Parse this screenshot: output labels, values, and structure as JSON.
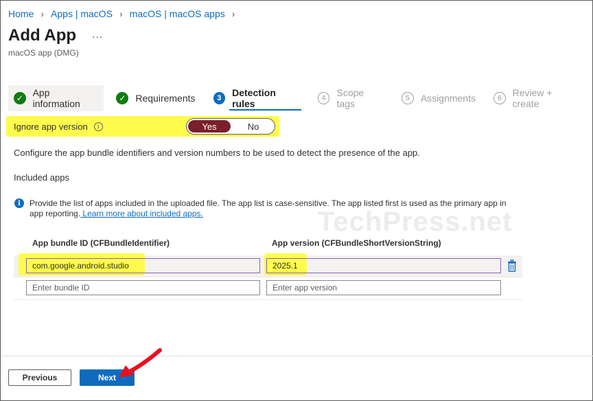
{
  "breadcrumb": {
    "items": [
      "Home",
      "Apps | macOS",
      "macOS | macOS apps"
    ]
  },
  "page": {
    "title": "Add App",
    "more": "...",
    "subtitle": "macOS app (DMG)"
  },
  "tabs": [
    {
      "label": "App information",
      "state": "complete"
    },
    {
      "label": "Requirements",
      "state": "complete"
    },
    {
      "label": "Detection rules",
      "number": "3",
      "state": "current"
    },
    {
      "label": "Scope tags",
      "number": "4",
      "state": "disabled"
    },
    {
      "label": "Assignments",
      "number": "5",
      "state": "disabled"
    },
    {
      "label": "Review + create",
      "number": "6",
      "state": "disabled"
    }
  ],
  "ignore_version": {
    "label": "Ignore app version",
    "yes": "Yes",
    "no": "No",
    "selected": "Yes"
  },
  "description": "Configure the app bundle identifiers and version numbers to be used to detect the presence of the app.",
  "included_apps": {
    "title": "Included apps",
    "info_text": "Provide the list of apps included in the uploaded file. The app list is case-sensitive. The app listed first is used as the primary app in app reporting.",
    "info_link": " Learn more about included apps.",
    "col_bundle": "App bundle ID (CFBundleIdentifier)",
    "col_version": "App version (CFBundleShortVersionString)",
    "rows": [
      {
        "bundle_id": "com.google.android.studio",
        "version": "2025.1"
      }
    ],
    "bundle_placeholder": "Enter bundle ID",
    "version_placeholder": "Enter app version"
  },
  "watermark": "TechPress.net",
  "footer": {
    "previous": "Previous",
    "next": "Next"
  },
  "colors": {
    "accent": "#0f6cbd",
    "success": "#107c10",
    "toggle_selected": "#7a1f2b",
    "highlight": "#fffb4d",
    "annotation_arrow": "#e81123"
  }
}
